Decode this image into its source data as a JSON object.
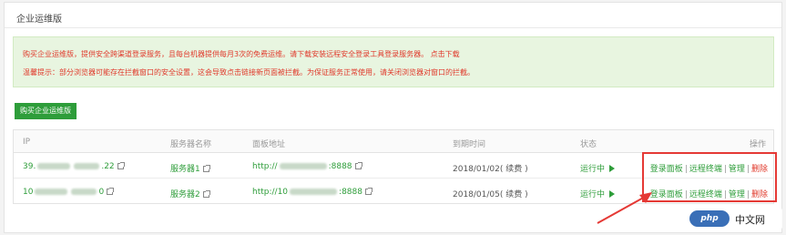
{
  "panel": {
    "title": "企业运维版"
  },
  "notice": {
    "line1": "购买企业运维版，提供安全跨渠道登录服务，且每台机器提供每月3次的免费运维。请下载安装远程安全登录工具登录服务器。",
    "line1_link": "点击下载",
    "line2": "温馨提示：部分浏览器可能存在拦截窗口的安全设置，这会导致点击链接新页面被拦截。为保证服务正常使用，请关闭浏览器对窗口的拦截。"
  },
  "buy_button": {
    "label": "购买企业运维版"
  },
  "colors": {
    "accent": "#2e9d3a",
    "danger": "#e0392b",
    "highlight": "#e53935"
  },
  "table": {
    "headers": {
      "ip": "IP",
      "server_name": "服务器名称",
      "panel_url": "面板地址",
      "expiry": "到期时间",
      "status": "状态",
      "actions": "操作"
    },
    "rows": [
      {
        "ip_prefix": "39.",
        "ip_suffix": ".22",
        "server_name": "服务器1",
        "url_prefix": "http://",
        "url_suffix": ":8888",
        "expiry": "2018/01/02( 续费 )",
        "status": "运行中",
        "actions": [
          "登录面板",
          "远程终端",
          "管理",
          "删除"
        ]
      },
      {
        "ip_prefix": "10",
        "ip_suffix": "0",
        "server_name": "服务器2",
        "url_prefix": "http://10",
        "url_suffix": ":8888",
        "expiry": "2018/01/05( 续费 )",
        "status": "运行中",
        "actions": [
          "登录面板",
          "远程终端",
          "管理",
          "删除"
        ]
      }
    ]
  },
  "watermark": {
    "logo": "php",
    "text": "中文网"
  }
}
